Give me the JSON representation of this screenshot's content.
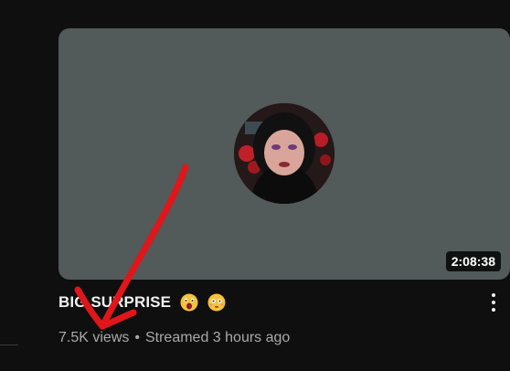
{
  "video": {
    "duration": "2:08:38",
    "title": "BIG SURPRISE",
    "title_emojis": [
      "face-with-open-mouth-emoji",
      "flushed-face-emoji"
    ],
    "views": "7.5K views",
    "separator": "•",
    "streamed": "Streamed 3 hours ago"
  },
  "colors": {
    "background": "#0f0f0f",
    "thumbnail": "#525a5a",
    "title": "#f1f1f1",
    "meta": "#aaaaaa",
    "annotation_arrow": "#e0161b"
  },
  "icons": {
    "menu": "vertical-ellipsis-icon",
    "annotation": "red-arrow-annotation"
  }
}
